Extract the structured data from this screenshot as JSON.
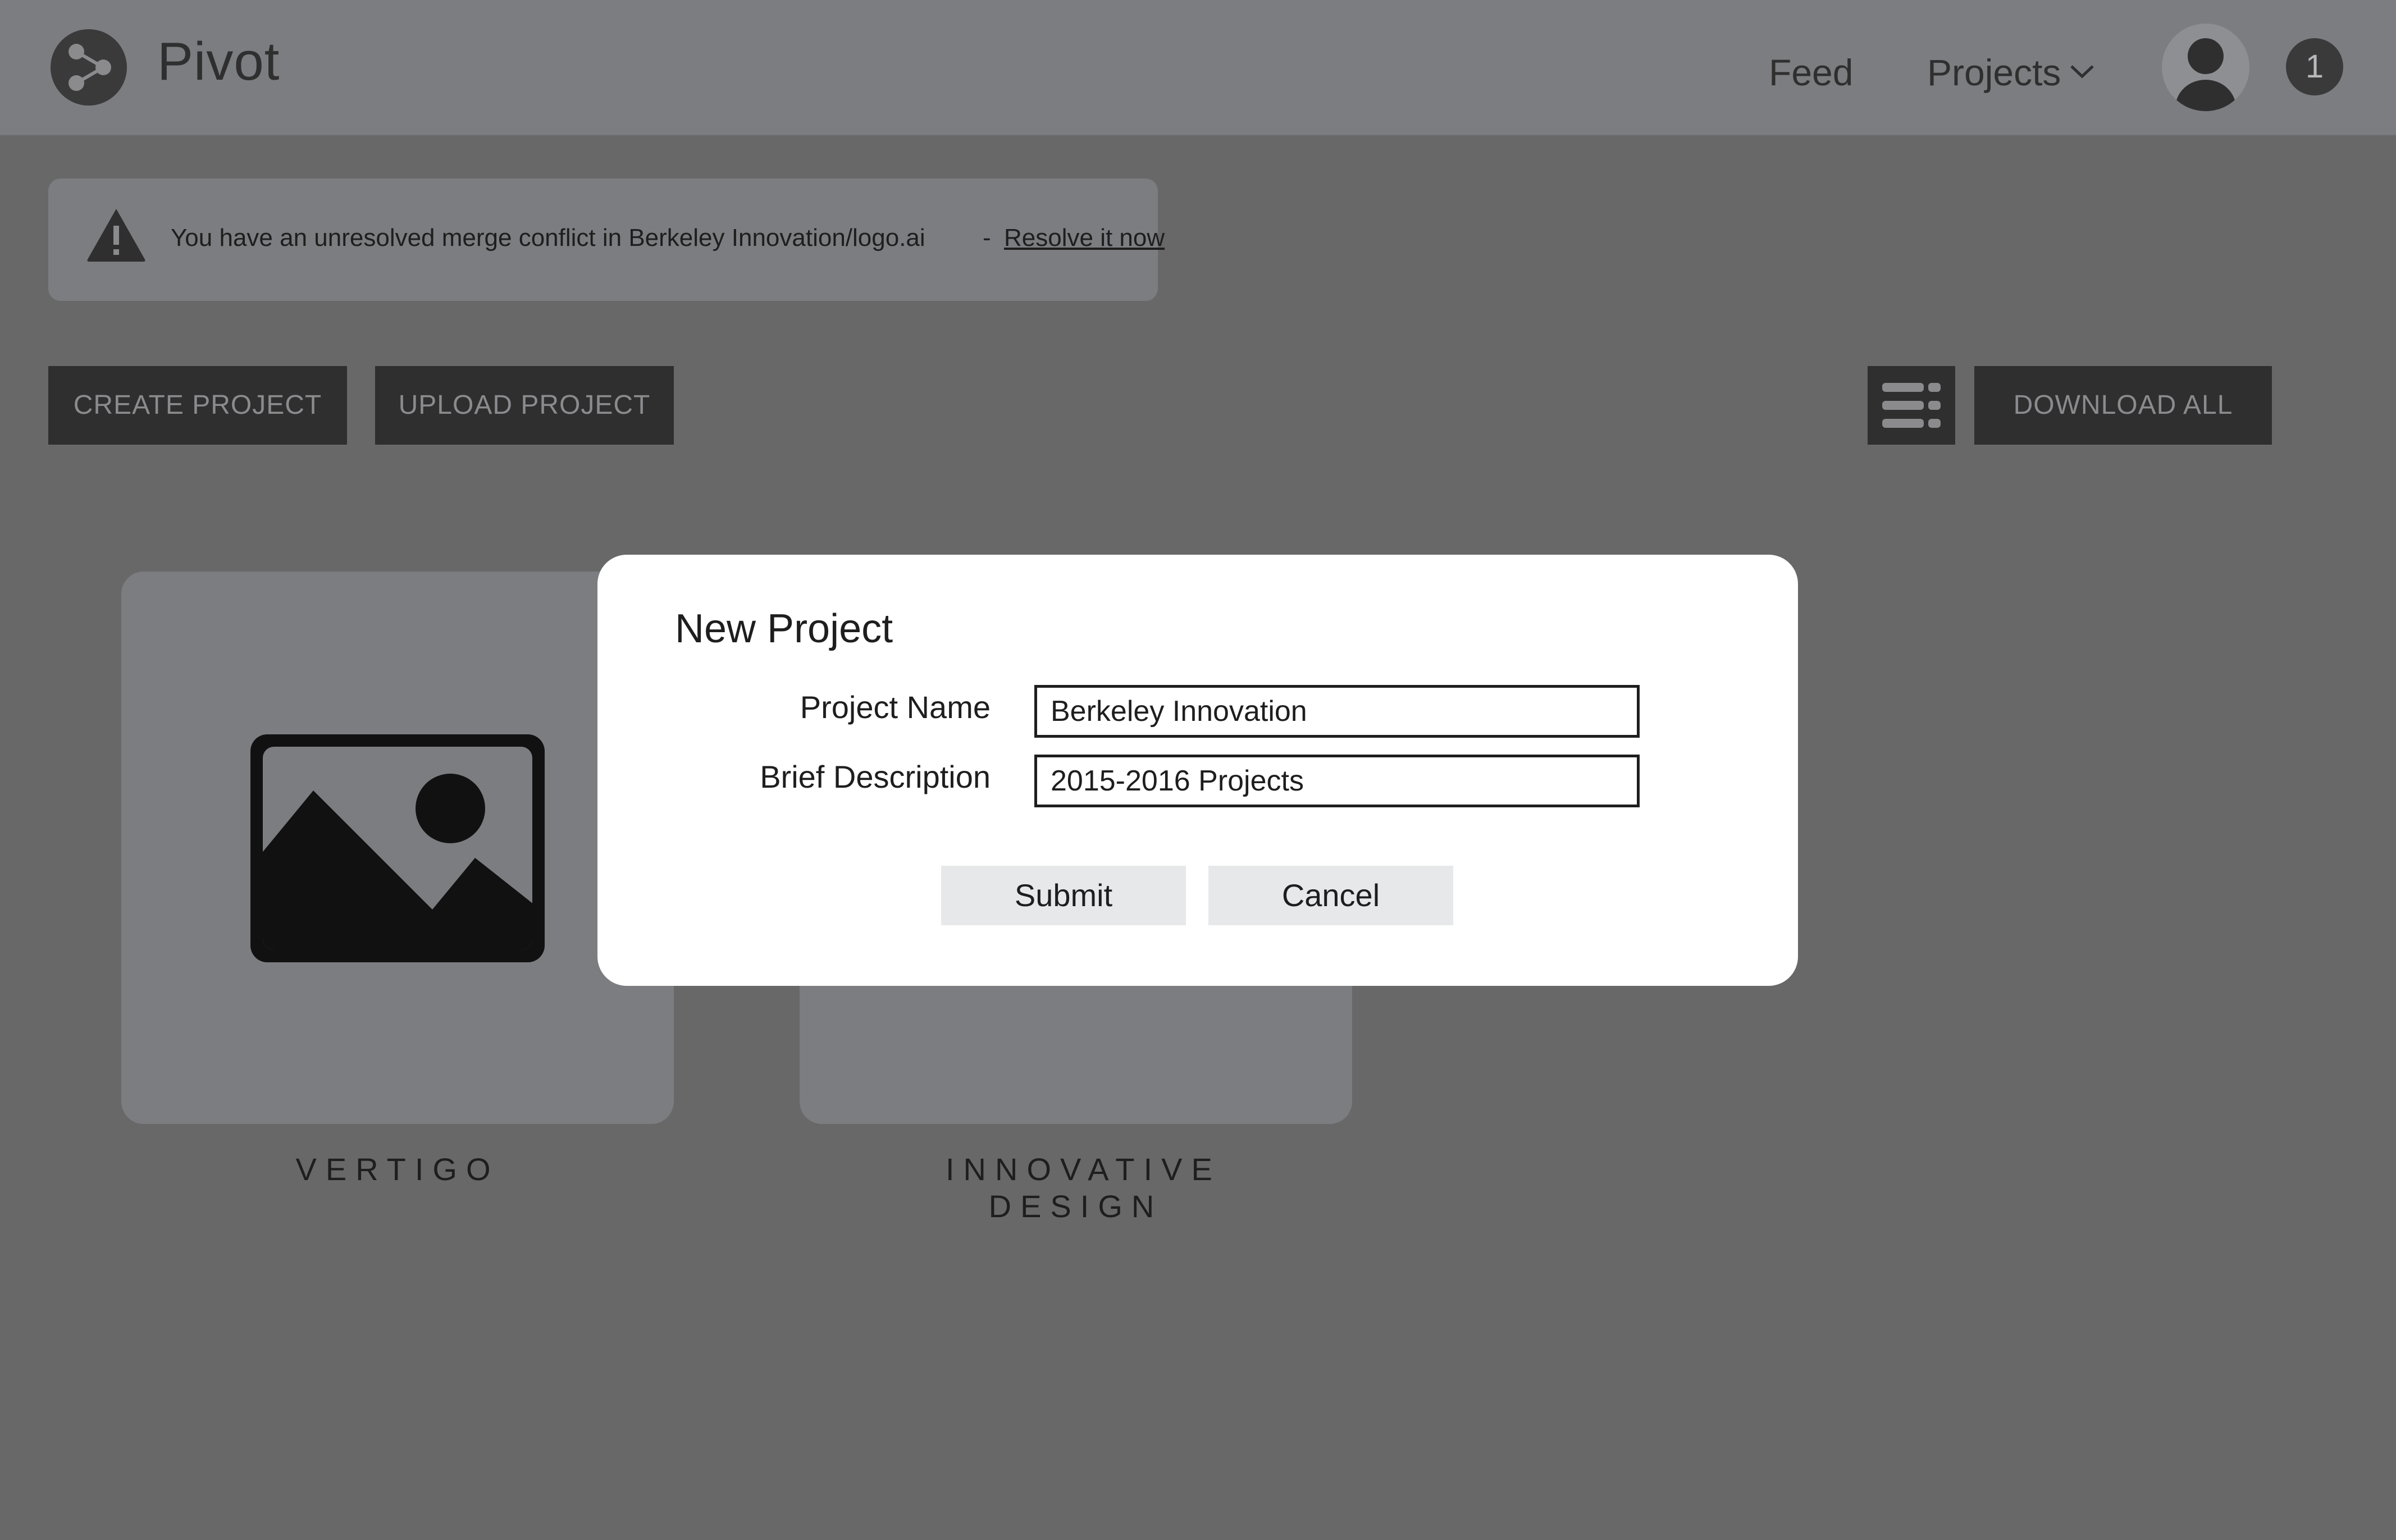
{
  "app": {
    "title": "Pivot",
    "logo_icon": "share-nodes-icon"
  },
  "nav": {
    "feed": "Feed",
    "projects": "Projects",
    "projects_icon": "chevron-down-icon",
    "avatar_icon": "user-avatar-icon",
    "notification_count": "1"
  },
  "alert": {
    "icon": "warning-triangle-icon",
    "message": "You have an unresolved merge conflict in Berkeley Innovation/logo.ai",
    "separator": "-",
    "link": "Resolve it now"
  },
  "toolbar": {
    "create": "CREATE PROJECT",
    "upload": "UPLOAD PROJECT",
    "view_icon": "list-view-icon",
    "download": "DOWNLOAD ALL"
  },
  "projects": [
    {
      "name": "VERTIGO",
      "thumbnail_icon": "image-placeholder-icon"
    },
    {
      "name": "INNOVATIVE DESIGN"
    }
  ],
  "modal": {
    "title": "New Project",
    "name_label": "Project Name",
    "name_value": "Berkeley Innovation",
    "desc_label": "Brief Description",
    "desc_value": "2015-2016 Projects",
    "submit": "Submit",
    "cancel": "Cancel"
  },
  "colors": {
    "backdrop": "#686868",
    "topbar": "#7c7d80",
    "dark_button": "#2f2f30",
    "modal": "#ffffff",
    "modal_button": "#e7e8ea"
  }
}
